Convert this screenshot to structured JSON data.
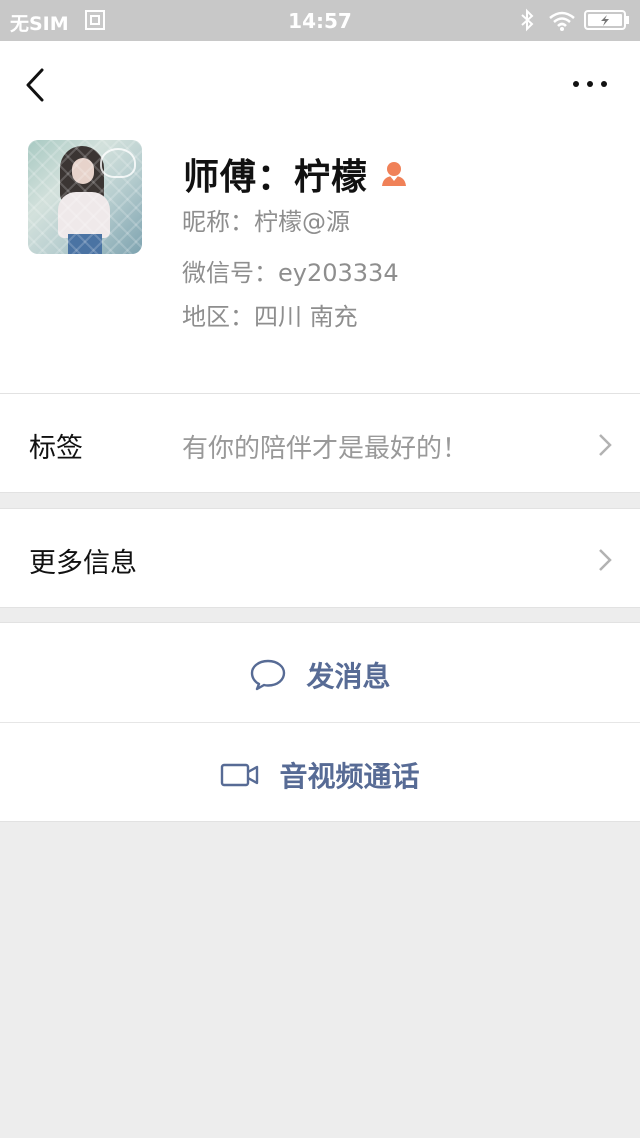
{
  "status_bar": {
    "carrier": "无SIM",
    "time": "14:57"
  },
  "header": {
    "back_icon": "chevron-left-icon",
    "more_icon": "more-dots-icon"
  },
  "profile": {
    "name": "师傅：柠檬",
    "gender_icon": "female-user-icon",
    "gender_color": "#f08158",
    "nickname_line": "昵称：柠檬@源",
    "wechat_id_line": "微信号：ey203334",
    "region_line": "地区：四川  南充"
  },
  "rows": {
    "tag_label": "标签",
    "tag_value": "有你的陪伴才是最好的！",
    "more_info_label": "更多信息"
  },
  "actions": {
    "message_label": "发消息",
    "call_label": "音视频通话",
    "accent_color": "#576b95"
  }
}
